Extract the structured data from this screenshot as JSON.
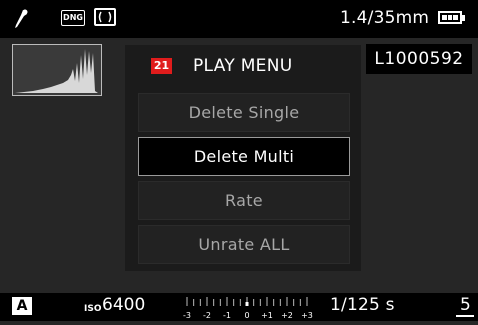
{
  "top_bar": {
    "lens_icon": "lens-profile-icon",
    "file_format": "DNG",
    "metering_icon": "metering-mode-icon",
    "lens_info": "1.4/35mm",
    "battery_icon": "battery-icon"
  },
  "histogram_icon": "histogram",
  "filename": "L1000592",
  "menu": {
    "page_number": "21",
    "title": "PLAY MENU",
    "items": [
      {
        "label": "Delete Single"
      },
      {
        "label": "Delete Multi"
      },
      {
        "label": "Rate"
      },
      {
        "label": "Unrate ALL"
      }
    ],
    "selected_index": 1
  },
  "bottom_bar": {
    "exposure_mode": "A",
    "iso_label": "ISO",
    "iso_value": "6400",
    "ev_labels": [
      "-3",
      "-2",
      "-1",
      "0",
      "+1",
      "+2",
      "+3"
    ],
    "shutter_speed": "1/125 s",
    "frames_remaining": "5"
  },
  "colors": {
    "menu_number_badge": "#e01c1c",
    "background": "#262626"
  }
}
